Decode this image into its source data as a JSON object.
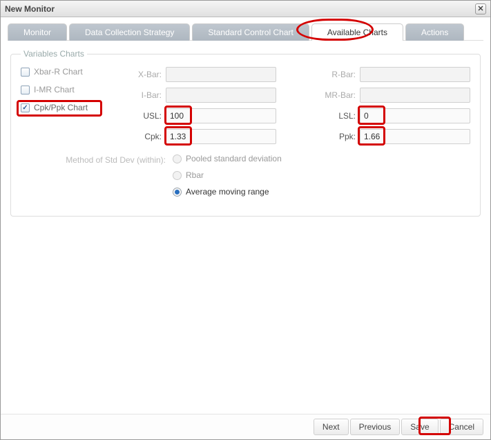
{
  "window": {
    "title": "New Monitor"
  },
  "tabs": {
    "monitor": "Monitor",
    "dcs": "Data Collection Strategy",
    "scc": "Standard Control Chart",
    "avail": "Available Charts",
    "actions": "Actions"
  },
  "fieldset": {
    "legend": "Variables Charts"
  },
  "charts": {
    "xbarr": {
      "label": "Xbar-R Chart",
      "checked": false
    },
    "imr": {
      "label": "I-MR Chart",
      "checked": false
    },
    "cpk": {
      "label": "Cpk/Ppk Chart",
      "checked": true
    }
  },
  "fields": {
    "xbar": {
      "label": "X-Bar:",
      "value": ""
    },
    "rbar": {
      "label": "R-Bar:",
      "value": ""
    },
    "ibar": {
      "label": "I-Bar:",
      "value": ""
    },
    "mrbar": {
      "label": "MR-Bar:",
      "value": ""
    },
    "usl": {
      "label": "USL:",
      "value": "100"
    },
    "lsl": {
      "label": "LSL:",
      "value": "0"
    },
    "cpk": {
      "label": "Cpk:",
      "value": "1.33"
    },
    "ppk": {
      "label": "Ppk:",
      "value": "1.66"
    }
  },
  "method": {
    "label": "Method of Std Dev (within):",
    "options": {
      "pooled": "Pooled standard deviation",
      "rbar": "Rbar",
      "amr": "Average moving range"
    },
    "selected": "amr"
  },
  "buttons": {
    "next": "Next",
    "previous": "Previous",
    "save": "Save",
    "cancel": "Cancel"
  }
}
